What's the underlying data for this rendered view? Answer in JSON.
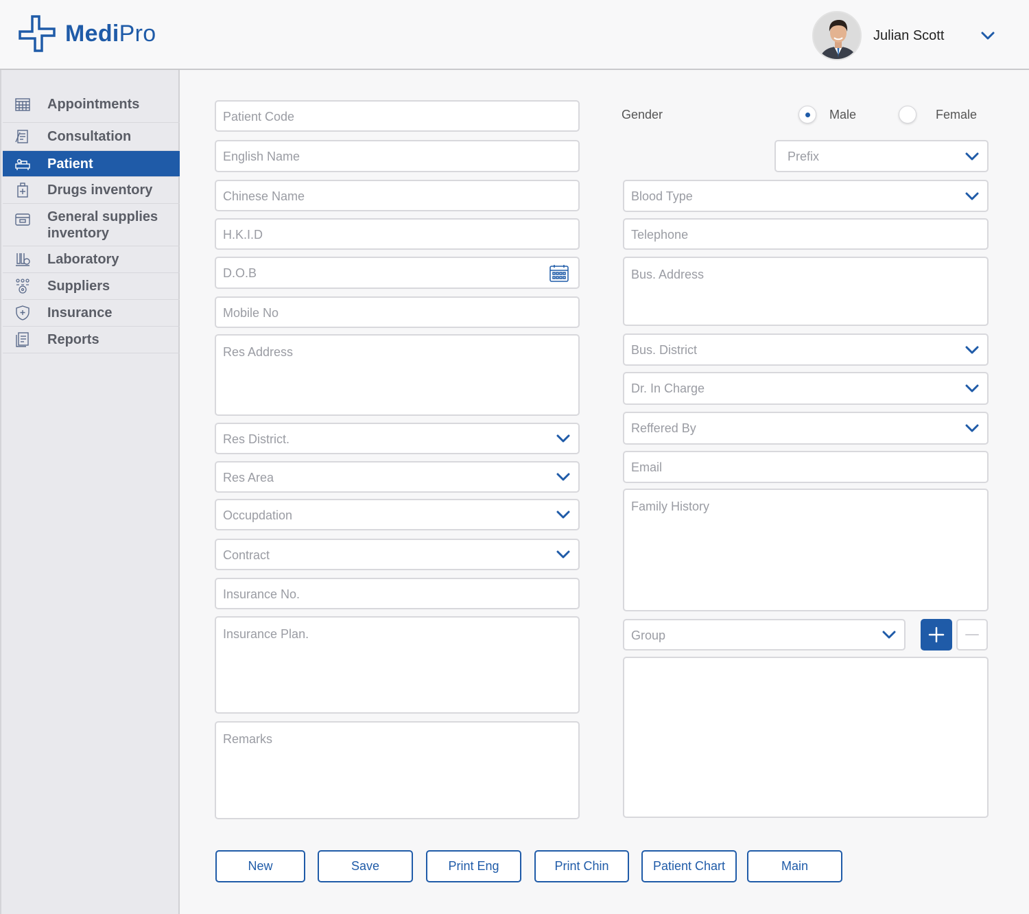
{
  "brand": {
    "name_bold": "Medi",
    "name_light": "Pro",
    "color": "#1f5ba8"
  },
  "user": {
    "name": "Julian Scott"
  },
  "sidebar": {
    "items": [
      {
        "label": "Appointments",
        "icon": "calendar-icon",
        "active": false
      },
      {
        "label": "Consultation",
        "icon": "clipboard-icon",
        "active": false
      },
      {
        "label": "Patient",
        "icon": "bed-icon",
        "active": true
      },
      {
        "label": "Drugs inventory",
        "icon": "medicine-bottle-icon",
        "active": false
      },
      {
        "label": "General supplies inventory",
        "icon": "box-icon",
        "active": false
      },
      {
        "label": "Laboratory",
        "icon": "lab-icon",
        "active": false
      },
      {
        "label": "Suppliers",
        "icon": "people-icon",
        "active": false
      },
      {
        "label": "Insurance",
        "icon": "shield-icon",
        "active": false
      },
      {
        "label": "Reports",
        "icon": "document-icon",
        "active": false
      }
    ]
  },
  "form": {
    "left": {
      "patient_code": "Patient Code",
      "english_name": "English Name",
      "chinese_name": "Chinese Name",
      "hkid": "H.K.I.D",
      "dob": "D.O.B",
      "mobile_no": "Mobile No",
      "res_address": "Res Address",
      "res_district": "Res District.",
      "res_area": "Res Area",
      "occupation": "Occupdation",
      "contract": "Contract",
      "insurance_no": "Insurance No.",
      "insurance_plan": "Insurance Plan.",
      "remarks": "Remarks"
    },
    "right": {
      "gender_label": "Gender",
      "gender_options": [
        "Male",
        "Female"
      ],
      "gender_selected": "Male",
      "prefix": "Prefix",
      "blood_type": "Blood Type",
      "telephone": "Telephone",
      "bus_address": "Bus. Address",
      "bus_district": "Bus. District",
      "dr_in_charge": "Dr. In Charge",
      "referred_by": "Reffered By",
      "email": "Email",
      "family_history": "Family History",
      "group": "Group"
    }
  },
  "actions": {
    "new": "New",
    "save": "Save",
    "print_eng": "Print Eng",
    "print_chin": "Print Chin",
    "patient_chart": "Patient Chart",
    "main": "Main"
  }
}
